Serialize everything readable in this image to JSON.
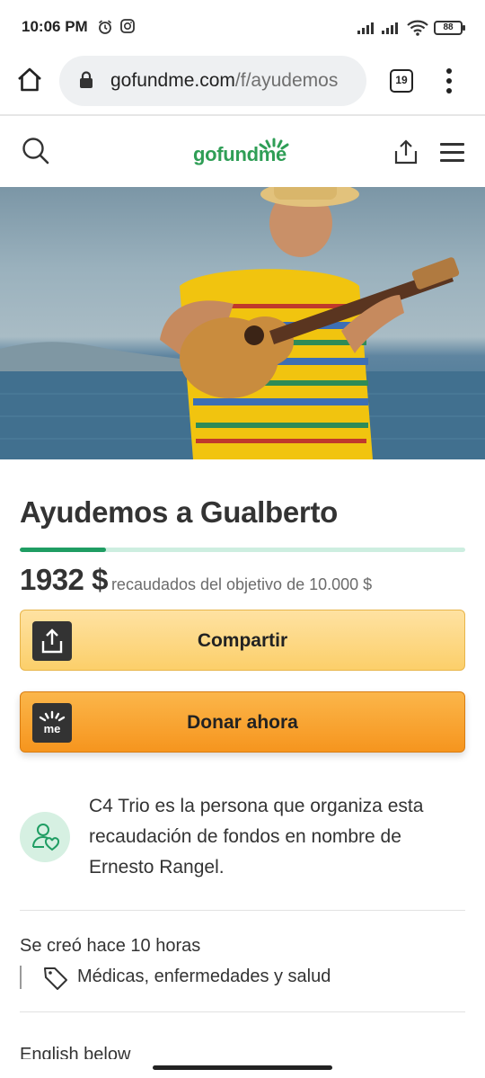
{
  "status_bar": {
    "time": "10:06 PM",
    "battery": "88"
  },
  "browser": {
    "url_host": "gofundme.com",
    "url_path": "/f/ayudemos",
    "tabs_count": "19"
  },
  "site": {
    "logo_text": "gofundme"
  },
  "campaign": {
    "title": "Ayudemos a Gualberto",
    "raised": "1932 $",
    "goal_text": "recaudados del objetivo de 10.000 $",
    "progress_fraction": 0.1932
  },
  "buttons": {
    "share_label": "Compartir",
    "donate_label": "Donar ahora",
    "donate_icon_text": "me"
  },
  "organizer": {
    "text": "C4 Trio es la persona que organiza esta recaudación de fondos en nombre de Ernesto Rangel."
  },
  "meta": {
    "created": "Se creó hace 10 horas",
    "category": "Médicas, enfermedades y salud"
  },
  "description": {
    "first_line": "English below"
  },
  "colors": {
    "brand_green": "#2f9e56",
    "progress_fill": "#1f9d63",
    "donate_orange": "#f6951e",
    "share_yellow": "#fccf6a"
  }
}
